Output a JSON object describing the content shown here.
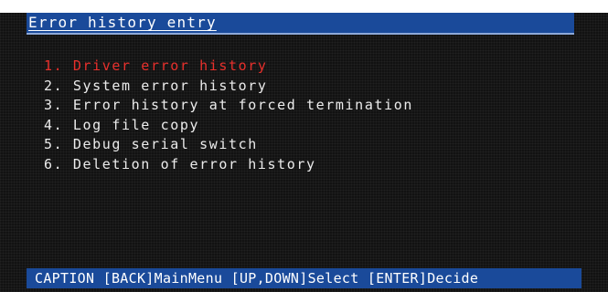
{
  "title": "Error history entry",
  "menu": {
    "selected_index": 0,
    "items": [
      {
        "label": "1. Driver error history"
      },
      {
        "label": "2. System error history"
      },
      {
        "label": "3. Error history at forced termination"
      },
      {
        "label": "4. Log file copy"
      },
      {
        "label": "5. Debug serial switch"
      },
      {
        "label": "6. Deletion of error history"
      }
    ]
  },
  "footer": {
    "text": "CAPTION [BACK]MainMenu [UP,DOWN]Select [ENTER]Decide"
  },
  "colors": {
    "background": "#121212",
    "bar": "#1a4a9a",
    "text": "#ececec",
    "selected": "#e8302c"
  }
}
